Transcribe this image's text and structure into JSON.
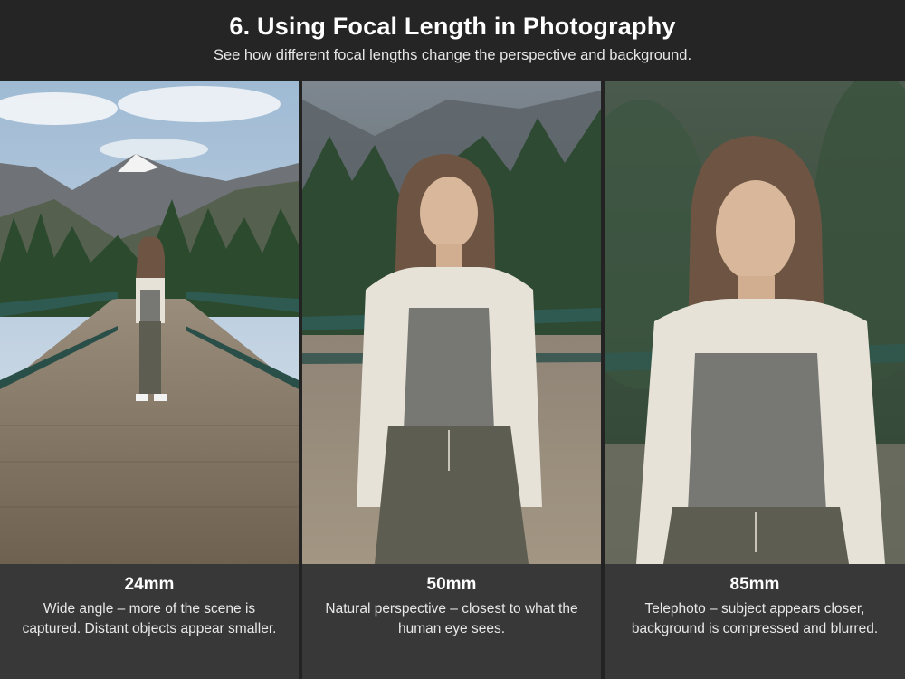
{
  "header": {
    "title": "6. Using Focal Length in Photography",
    "subtitle": "See how different focal lengths change the perspective and background."
  },
  "panels": [
    {
      "focal_length": "24mm",
      "description": "Wide angle – more of the scene is captured. Distant objects appear smaller."
    },
    {
      "focal_length": "50mm",
      "description": "Natural perspective – closest to what the human eye sees."
    },
    {
      "focal_length": "85mm",
      "description": "Telephoto – subject appears closer, background is compressed and blurred."
    }
  ],
  "colors": {
    "background": "#232323",
    "caption_panel": "#383838",
    "railing": "#2f5a52",
    "deck": "#8a7b68",
    "tank_top": "#777774",
    "shirt": "#e7e2d8",
    "pants": "#5d5d52"
  }
}
